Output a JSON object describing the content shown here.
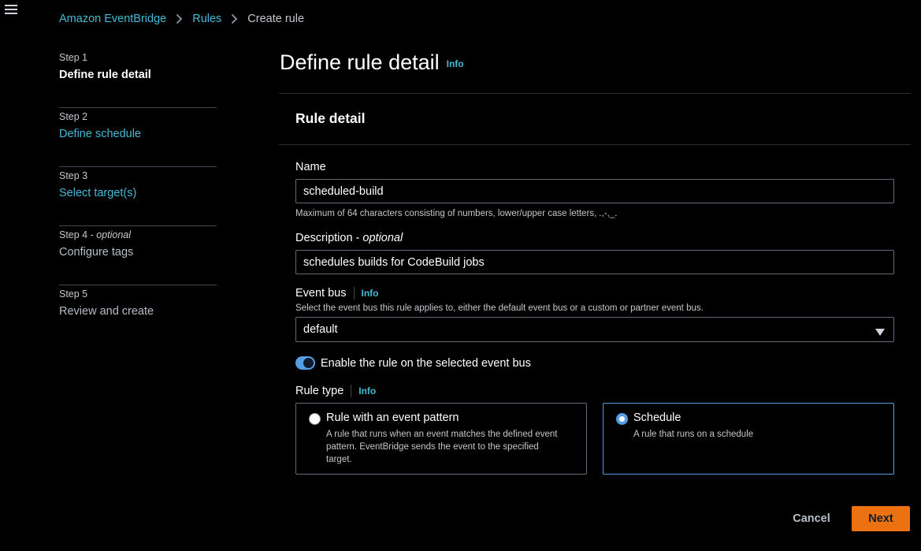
{
  "breadcrumb": {
    "items": [
      "Amazon EventBridge",
      "Rules"
    ],
    "current": "Create rule"
  },
  "steps": [
    {
      "number": "Step 1",
      "optional": "",
      "label": "Define rule detail",
      "state": "active"
    },
    {
      "number": "Step 2",
      "optional": "",
      "label": "Define schedule",
      "state": "link"
    },
    {
      "number": "Step 3",
      "optional": "",
      "label": "Select target(s)",
      "state": "link"
    },
    {
      "number": "Step 4",
      "optional": "optional",
      "label": "Configure tags",
      "state": "disabled"
    },
    {
      "number": "Step 5",
      "optional": "",
      "label": "Review and create",
      "state": "disabled"
    }
  ],
  "page": {
    "title": "Define rule detail",
    "info": "Info"
  },
  "panel": {
    "header": "Rule detail",
    "name": {
      "label": "Name",
      "value": "scheduled-build",
      "hint": "Maximum of 64 characters consisting of numbers, lower/upper case letters, .,-,_."
    },
    "description": {
      "label": "Description",
      "optional": "optional",
      "value": "schedules builds for CodeBuild jobs"
    },
    "event_bus": {
      "label": "Event bus",
      "info": "Info",
      "hint": "Select the event bus this rule applies to, either the default event bus or a custom or partner event bus.",
      "value": "default"
    },
    "enable_toggle": {
      "label": "Enable the rule on the selected event bus",
      "on": true
    },
    "rule_type": {
      "label": "Rule type",
      "info": "Info",
      "options": [
        {
          "title": "Rule with an event pattern",
          "desc": "A rule that runs when an event matches the defined event pattern. EventBridge sends the event to the specified target.",
          "selected": false
        },
        {
          "title": "Schedule",
          "desc": "A rule that runs on a schedule",
          "selected": true
        }
      ]
    }
  },
  "footer": {
    "cancel": "Cancel",
    "next": "Next"
  },
  "colors": {
    "link": "#44b9d6",
    "primary_button": "#ec7211",
    "selected_border": "#539fe5"
  }
}
